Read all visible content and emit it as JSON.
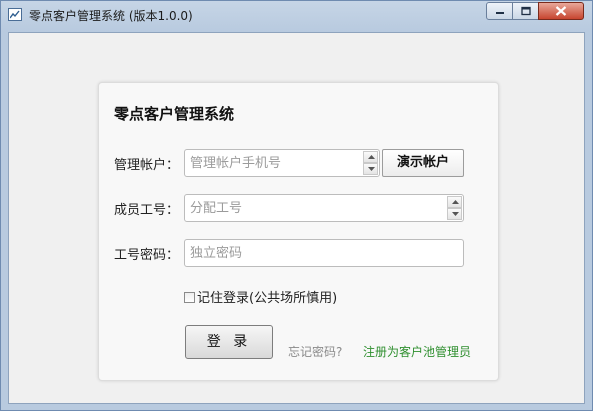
{
  "window": {
    "title": "零点客户管理系统 (版本1.0.0)",
    "icon": "chart-line-icon"
  },
  "controls": {
    "minimize_icon": "minimize-icon",
    "maximize_icon": "maximize-icon",
    "close_icon": "close-icon"
  },
  "form": {
    "heading": "零点客户管理系统",
    "account_label": "管理帐户：",
    "account_placeholder": "管理帐户手机号",
    "account_value": "",
    "demo_button": "演示帐户",
    "member_label": "成员工号：",
    "member_placeholder": "分配工号",
    "member_value": "",
    "password_label": "工号密码：",
    "password_placeholder": "独立密码",
    "password_value": "",
    "remember_label": "记住登录(公共场所慎用)",
    "remember_checked": false,
    "login_button": "登 录",
    "forgot_link": "忘记密码?",
    "register_link": "注册为客户池管理员"
  },
  "colors": {
    "titlebar": "#c6d5e6",
    "close_button": "#c7452f",
    "register_link": "#2f8f2f"
  }
}
